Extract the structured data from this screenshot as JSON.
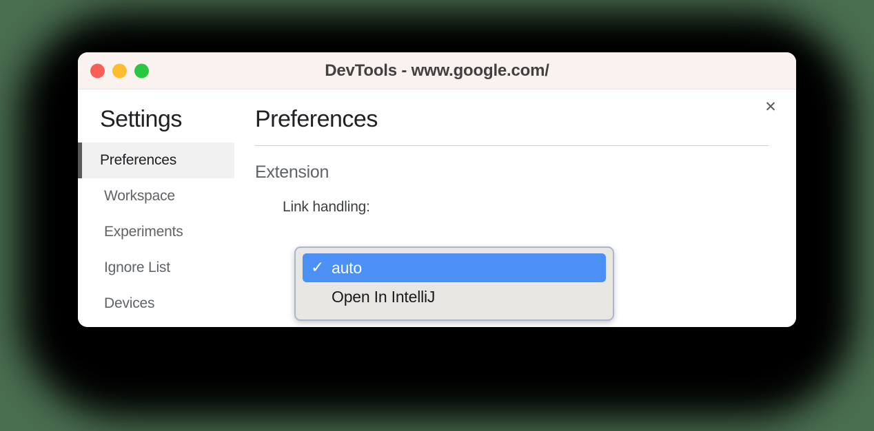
{
  "window": {
    "title": "DevTools - www.google.com/",
    "traffic_lights": [
      {
        "name": "close",
        "color": "#fa5f57"
      },
      {
        "name": "minimize",
        "color": "#febc2e"
      },
      {
        "name": "zoom",
        "color": "#28c840"
      }
    ]
  },
  "close_button": {
    "glyph": "✕"
  },
  "sidebar": {
    "title": "Settings",
    "items": [
      {
        "label": "Preferences",
        "active": true
      },
      {
        "label": "Workspace",
        "active": false
      },
      {
        "label": "Experiments",
        "active": false
      },
      {
        "label": "Ignore List",
        "active": false
      },
      {
        "label": "Devices",
        "active": false
      }
    ]
  },
  "content": {
    "title": "Preferences",
    "section_heading": "Extension",
    "field": {
      "label": "Link handling:",
      "selected_value": "auto"
    }
  },
  "select_popup": {
    "check_glyph": "✓",
    "options": [
      {
        "label": "auto",
        "selected": true
      },
      {
        "label": "Open In IntelliJ",
        "selected": false
      }
    ]
  },
  "colors": {
    "page_background": "#4a6e50",
    "titlebar_background": "#faf2ee",
    "accent_blue": "#4a90f5",
    "sidebar_active_background": "#f1f1f1",
    "sidebar_active_marker": "#5a5a5a"
  }
}
